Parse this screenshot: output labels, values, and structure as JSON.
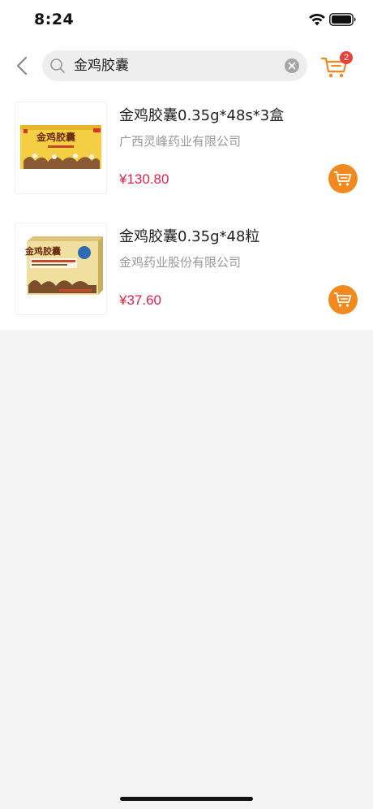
{
  "status_bar": {
    "time": "8:24"
  },
  "search": {
    "query": "金鸡胶囊"
  },
  "cart": {
    "badge_count": "2"
  },
  "products": [
    {
      "name": "金鸡胶囊0.35g*48s*3盒",
      "manufacturer": "广西灵峰药业有限公司",
      "price": "¥130.80",
      "box_title": "金鸡胶囊"
    },
    {
      "name": "金鸡胶囊0.35g*48粒",
      "manufacturer": "金鸡药业股份有限公司",
      "price": "¥37.60",
      "box_title": "金鸡胶囊"
    }
  ],
  "colors": {
    "accent": "#f08a1e",
    "price": "#e3204a",
    "badge": "#e8413c"
  },
  "icons": [
    "back-arrow-icon",
    "search-icon",
    "clear-icon",
    "cart-icon",
    "add-to-cart-icon",
    "wifi-icon",
    "battery-icon"
  ]
}
